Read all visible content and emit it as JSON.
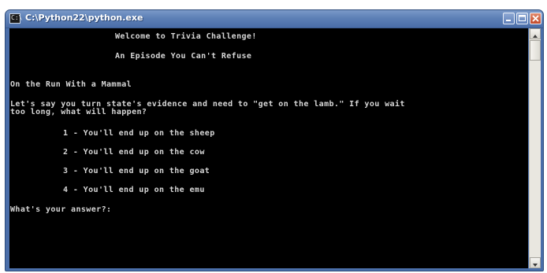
{
  "window": {
    "title": "C:\\Python22\\python.exe",
    "controls": {
      "minimize": "minimize-icon",
      "maximize": "maximize-icon",
      "close": "close-icon"
    }
  },
  "console": {
    "welcome": "Welcome to Trivia Challenge!",
    "episode": "An Episode You Can't Refuse",
    "category": "On the Run With a Mammal",
    "question_line1": "Let's say you turn state's evidence and need to \"get on the lamb.\" If you wait",
    "question_line2": "too long, what will happen?",
    "options": [
      "1 - You'll end up on the sheep",
      "2 - You'll end up on the cow",
      "3 - You'll end up on the goat",
      "4 - You'll end up on the emu"
    ],
    "prompt": "What's your answer?:"
  },
  "colors": {
    "console_bg": "#000000",
    "console_text": "#d6d6d6",
    "titlebar": "#5d80b6",
    "close_button": "#c14a2b"
  }
}
